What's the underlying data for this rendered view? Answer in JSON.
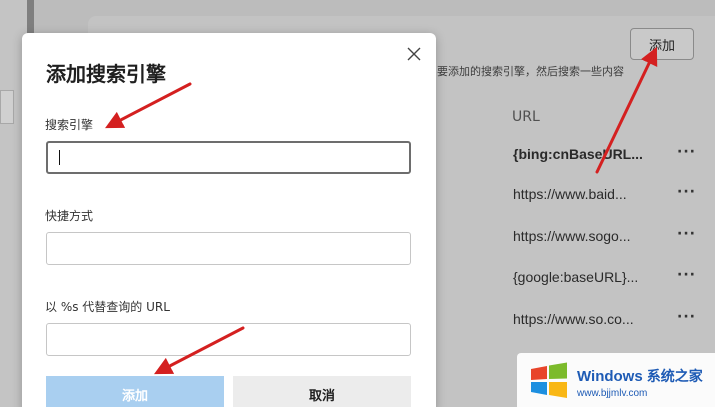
{
  "background": {
    "add_button": "添加",
    "hint_text": "要添加的搜索引擎，然后搜索一些内容",
    "url_header": "URL",
    "url_rows": [
      {
        "text": "{bing:cnBaseURL...",
        "bold": true
      },
      {
        "text": "https://www.baid...",
        "bold": false
      },
      {
        "text": "https://www.sogo...",
        "bold": false
      },
      {
        "text": "{google:baseURL}...",
        "bold": false
      },
      {
        "text": "https://www.so.co...",
        "bold": false
      }
    ],
    "more_label": "···"
  },
  "dialog": {
    "title": "添加搜索引擎",
    "fields": {
      "search_engine": {
        "label": "搜索引擎",
        "value": ""
      },
      "shortcut": {
        "label": "快捷方式",
        "value": ""
      },
      "url": {
        "label": "以 %s 代替查询的 URL",
        "value": ""
      }
    },
    "add_button": "添加",
    "cancel_button": "取消"
  },
  "watermark": {
    "brand": "Windows",
    "brand_cn": "系统之家",
    "url": "www.bjjmlv.com"
  },
  "colors": {
    "arrow": "#d42020",
    "primary_disabled": "#a9cff0",
    "overlay": "#bcbcbc"
  }
}
